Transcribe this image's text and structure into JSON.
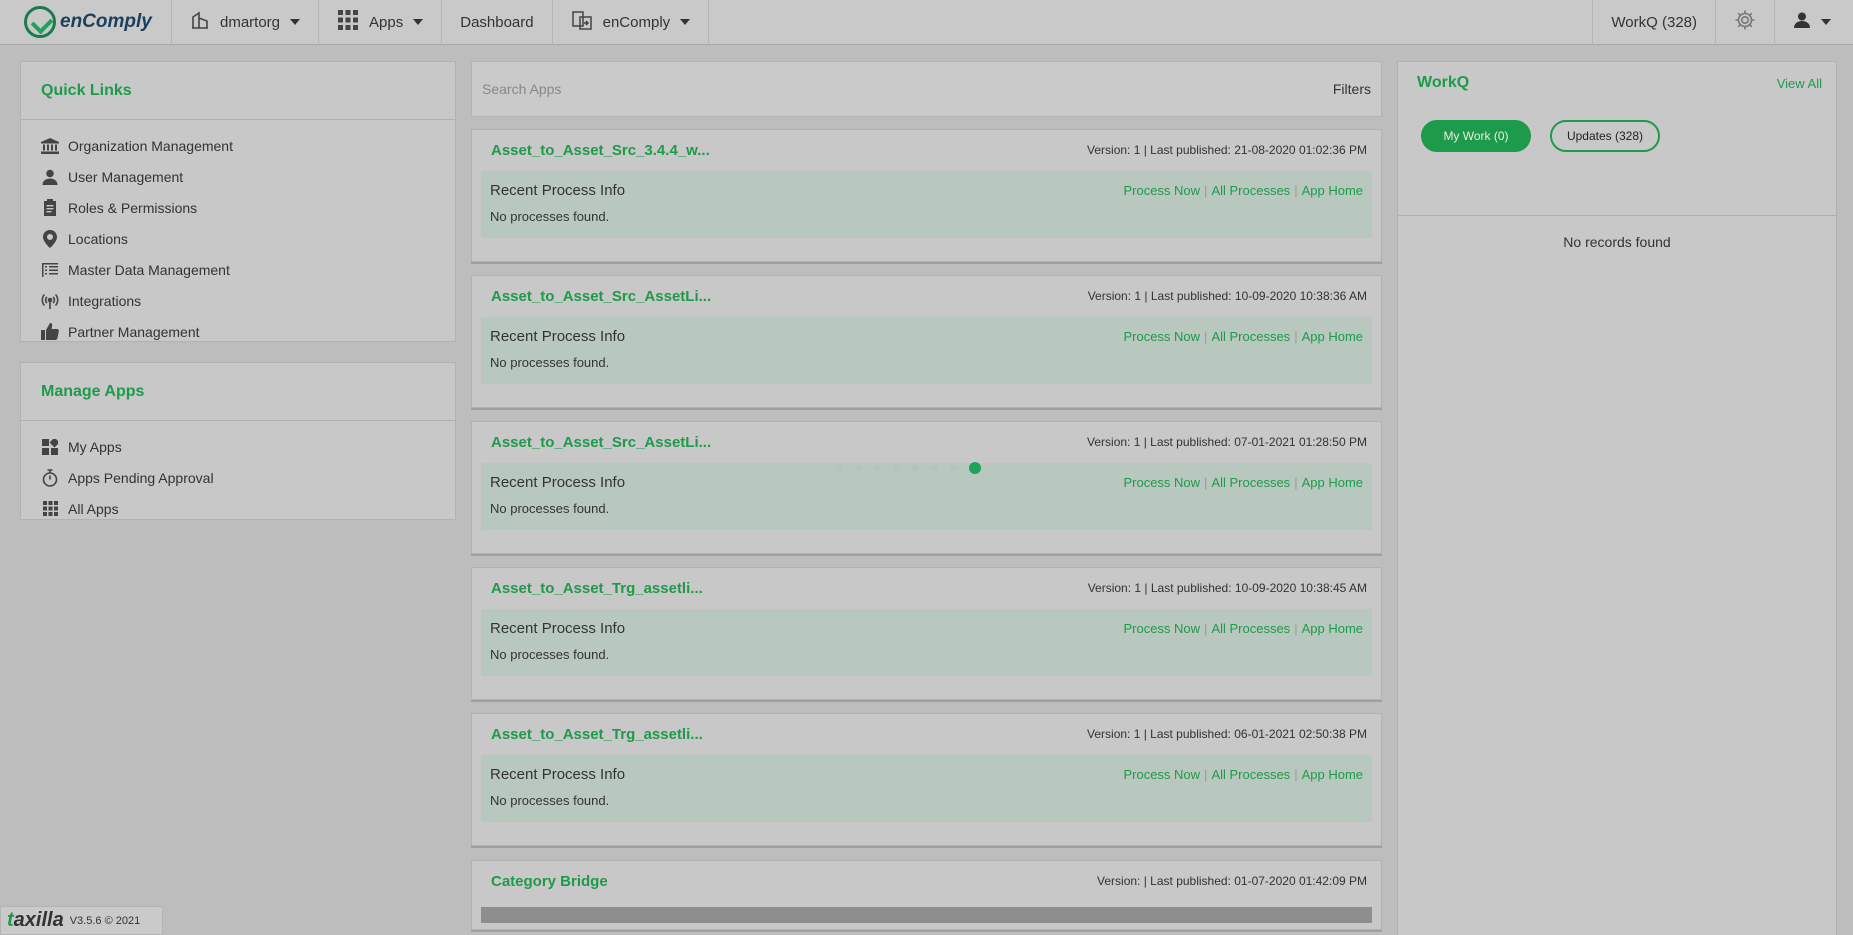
{
  "nav": {
    "brand": "enComply",
    "org": "dmartorg",
    "apps": "Apps",
    "dashboard": "Dashboard",
    "product": "enComply",
    "workq": "WorkQ (328)"
  },
  "quick_links": {
    "title": "Quick Links",
    "items": [
      {
        "label": "Organization Management",
        "icon": "bank-icon"
      },
      {
        "label": "User Management",
        "icon": "user-icon"
      },
      {
        "label": "Roles & Permissions",
        "icon": "clipboard-icon"
      },
      {
        "label": "Locations",
        "icon": "location-pin-icon"
      },
      {
        "label": "Master Data Management",
        "icon": "grid-list-icon"
      },
      {
        "label": "Integrations",
        "icon": "broadcast-icon"
      },
      {
        "label": "Partner Management",
        "icon": "thumbs-up-icon"
      }
    ]
  },
  "manage_apps": {
    "title": "Manage Apps",
    "items": [
      {
        "label": "My Apps",
        "icon": "apps-tiles-icon"
      },
      {
        "label": "Apps Pending Approval",
        "icon": "stopwatch-icon"
      },
      {
        "label": "All Apps",
        "icon": "grid-icon"
      }
    ]
  },
  "search": {
    "placeholder": "Search Apps",
    "filters": "Filters"
  },
  "apps": [
    {
      "name": "Asset_to_Asset_Src_3.4.4_w...",
      "meta": "Version: 1 | Last published: 21-08-2020 01:02:36 PM"
    },
    {
      "name": "Asset_to_Asset_Src_AssetLi...",
      "meta": "Version: 1 | Last published: 10-09-2020 10:38:36 AM"
    },
    {
      "name": "Asset_to_Asset_Src_AssetLi...",
      "meta": "Version: 1 | Last published: 07-01-2021 01:28:50 PM"
    },
    {
      "name": "Asset_to_Asset_Trg_assetli...",
      "meta": "Version: 1 | Last published: 10-09-2020 10:38:45 AM"
    },
    {
      "name": "Asset_to_Asset_Trg_assetli...",
      "meta": "Version: 1 | Last published: 06-01-2021 02:50:38 PM"
    },
    {
      "name": "Category Bridge",
      "meta": "Version: | Last published: 01-07-2020 01:42:09 PM"
    }
  ],
  "card_labels": {
    "recent": "Recent Process Info",
    "process_now": "Process Now",
    "all_processes": "All Processes",
    "app_home": "App Home",
    "sep": "|",
    "no_processes": "No processes found."
  },
  "workq": {
    "title": "WorkQ",
    "view_all": "View All",
    "my_work": "My Work (0)",
    "updates": "Updates (328)",
    "empty": "No records found"
  },
  "footer": {
    "brand": "taxilla",
    "version": "V3.5.6 © 2021"
  },
  "colors": {
    "accent": "#1e9a4b",
    "background": "#bdbdbd"
  }
}
